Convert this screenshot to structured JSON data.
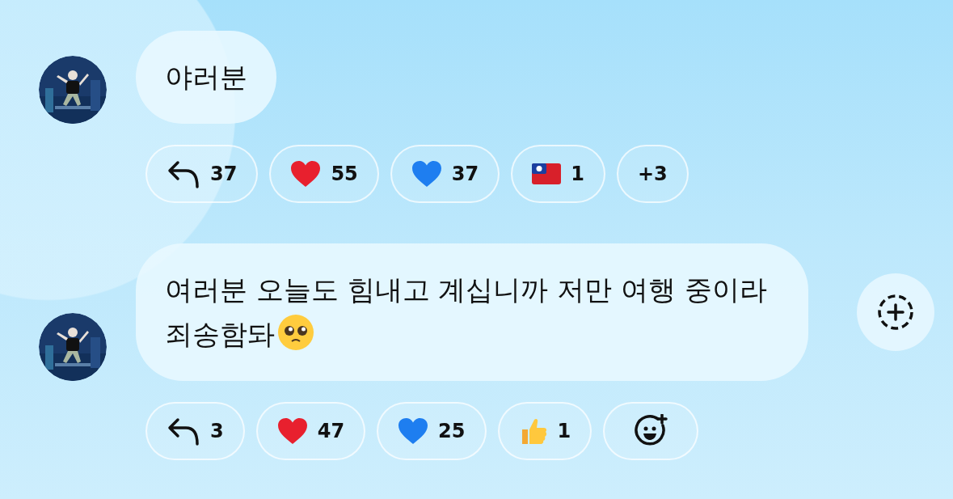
{
  "messages": [
    {
      "text": "야러분",
      "reactions": [
        {
          "kind": "reply",
          "count": "37"
        },
        {
          "kind": "heart",
          "color": "#e8202e",
          "count": "55"
        },
        {
          "kind": "heart",
          "color": "#1e7ef0",
          "count": "37"
        },
        {
          "kind": "flag",
          "count": "1"
        },
        {
          "kind": "more",
          "count": "+3"
        }
      ]
    },
    {
      "text": "여러분 오늘도 힘내고 계십니까 저만 여행 중이라 죄송함돠",
      "emoji": true,
      "add_reaction": true,
      "reactions": [
        {
          "kind": "reply",
          "count": "3"
        },
        {
          "kind": "heart",
          "color": "#e8202e",
          "count": "47"
        },
        {
          "kind": "heart",
          "color": "#1e7ef0",
          "count": "25"
        },
        {
          "kind": "thumb",
          "count": "1"
        },
        {
          "kind": "add"
        }
      ]
    }
  ]
}
